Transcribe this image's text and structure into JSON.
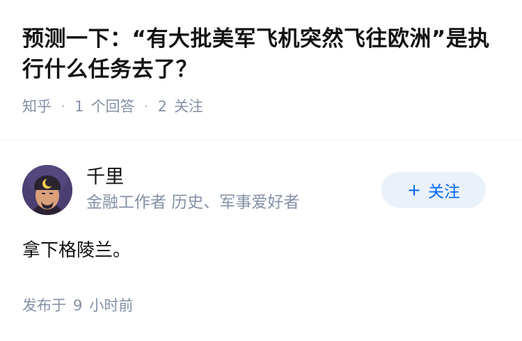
{
  "question": {
    "title": "预测一下：“有大批美军飞机突然飞往欧洲”是执行什么任务去了？",
    "source": "知乎",
    "answer_count": "1",
    "answer_label": "个回答",
    "follow_count": "2",
    "follow_label": "关注"
  },
  "author": {
    "name": "千里",
    "bio": "金融工作者 历史、军事爱好者",
    "follow_plus": "+",
    "follow_label": "关注",
    "avatar_icon": "crescent-moon-avatar"
  },
  "answer": {
    "content": "拿下格陵兰。",
    "time_prefix": "发布于",
    "time_value": "9",
    "time_unit": "小时前"
  },
  "colors": {
    "text": "#121212",
    "meta": "#8590a6",
    "accent": "#0066ff",
    "button_bg": "#eaf1fa",
    "divider": "#f0f2f7"
  }
}
